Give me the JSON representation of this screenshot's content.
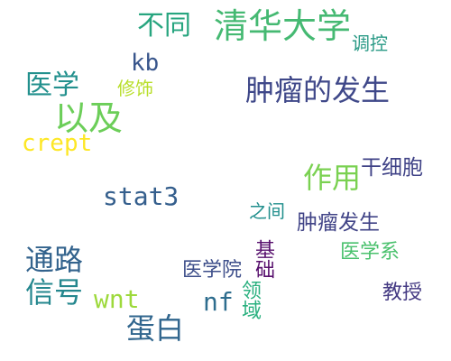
{
  "words": [
    {
      "text": "不同",
      "color": "#27a57f"
    },
    {
      "text": "清华大学",
      "color": "#45b972"
    },
    {
      "text": "调控",
      "color": "#2a9a86"
    },
    {
      "text": "kb",
      "color": "#39568c"
    },
    {
      "text": "医学",
      "color": "#22908d"
    },
    {
      "text": "修饰",
      "color": "#b8de29"
    },
    {
      "text": "肿瘤的发生",
      "color": "#3f4889"
    },
    {
      "text": "以及",
      "color": "#6cce59"
    },
    {
      "text": "crept",
      "color": "#fde725"
    },
    {
      "text": "干细胞",
      "color": "#404387"
    },
    {
      "text": "作用",
      "color": "#7ad151"
    },
    {
      "text": "stat3",
      "color": "#355f8d"
    },
    {
      "text": "之间",
      "color": "#218f8d"
    },
    {
      "text": "肿瘤发生",
      "color": "#414487"
    },
    {
      "text": "基础",
      "color": "#570f6d"
    },
    {
      "text": "医学系",
      "color": "#4ac16d"
    },
    {
      "text": "通路",
      "color": "#33638d"
    },
    {
      "text": "医学院",
      "color": "#3d4e8a"
    },
    {
      "text": "信号",
      "color": "#24878e"
    },
    {
      "text": "wnt",
      "color": "#9dd93b"
    },
    {
      "text": "nf",
      "color": "#2e6d8e"
    },
    {
      "text": "教授",
      "color": "#443a83"
    },
    {
      "text": "领域",
      "color": "#2ab07f"
    },
    {
      "text": "蛋白",
      "color": "#31668e"
    }
  ]
}
